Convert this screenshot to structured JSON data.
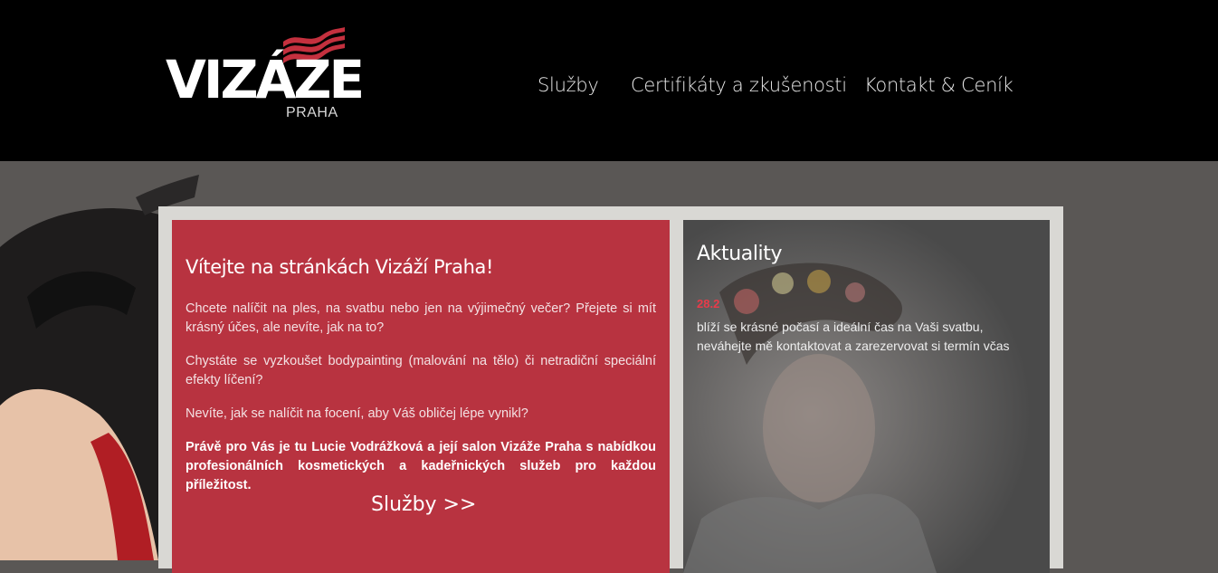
{
  "brand": {
    "name": "VIZÁZE",
    "city": "PRAHA",
    "accent": "#c4303e"
  },
  "nav": {
    "items": [
      {
        "label": "Služby"
      },
      {
        "label": "Certifikáty a zkušenosti"
      },
      {
        "label": "Kontakt & Ceník"
      }
    ]
  },
  "welcome": {
    "title": "Vítejte na stránkách Vizáží Praha!",
    "paragraphs": [
      "Chcete nalíčit na ples, na svatbu nebo jen na výjimečný večer? Přejete si mít krásný účes, ale nevíte, jak na to?",
      "Chystáte se vyzkoušet bodypainting (malování na tělo) či netradiční speciální efekty líčení?",
      "Nevíte, jak se nalíčit na focení, aby Váš obličej lépe vynikl?"
    ],
    "highlight": "Právě pro Vás je tu Lucie Vodrážková a její salon Vizáže Praha s nabídkou profesionálních kosmetických a kadeřnických služeb pro každou příležitost.",
    "services_link": "Služby >>",
    "bg_color": "#b83340"
  },
  "news": {
    "title": "Aktuality",
    "items": [
      {
        "date": "28.2",
        "text": "blíží se krásné počasí a ideální čas na Vaši svatbu, neváhejte mě kontaktovat a zarezervovat si termín včas"
      }
    ],
    "date_color": "#e83b4a"
  }
}
